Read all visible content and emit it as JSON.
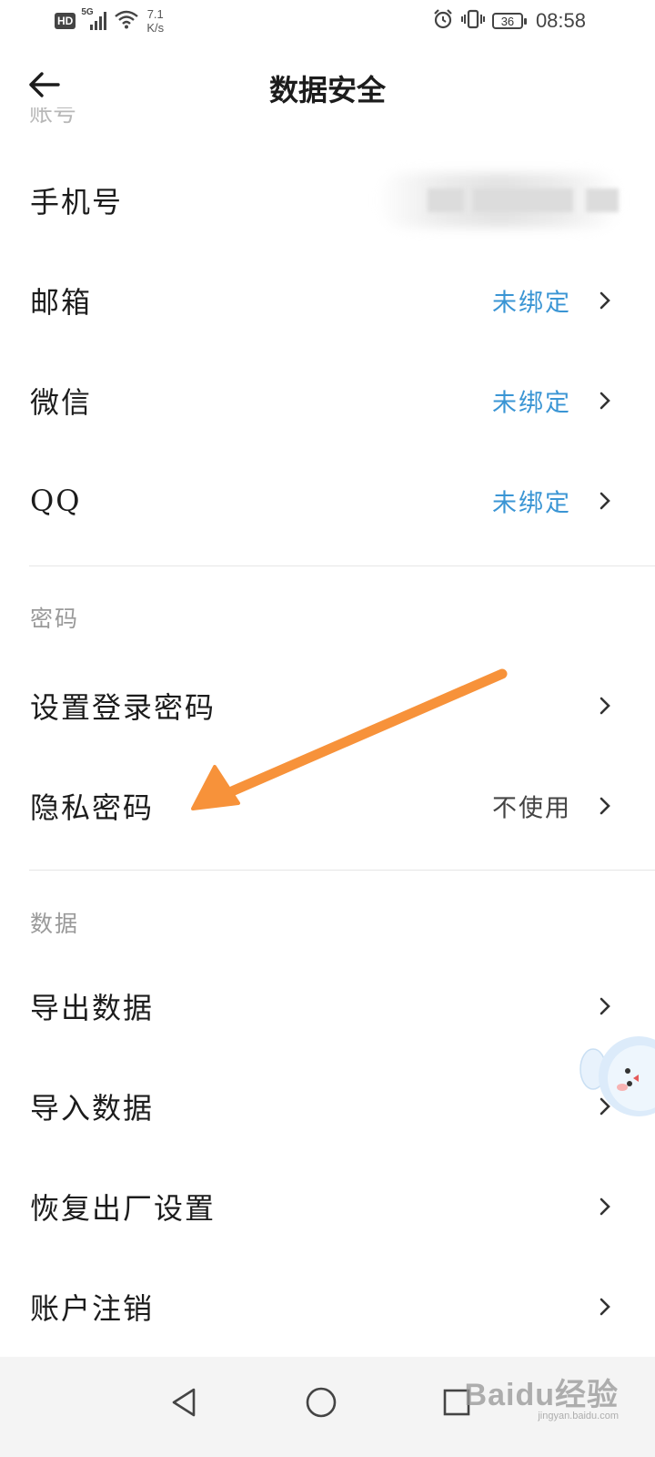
{
  "status_bar": {
    "hd": "HD",
    "network": "5G",
    "speed_value": "7.1",
    "speed_unit": "K/s",
    "battery": "36",
    "time": "08:58"
  },
  "header": {
    "title": "数据安全",
    "back_icon": "arrow-left-icon"
  },
  "account": {
    "partial_header": "账号",
    "rows": [
      {
        "label": "手机号",
        "value": ""
      },
      {
        "label": "邮箱",
        "value": "未绑定"
      },
      {
        "label": "微信",
        "value": "未绑定"
      },
      {
        "label": "QQ",
        "value": "未绑定"
      }
    ]
  },
  "password": {
    "header": "密码",
    "rows": [
      {
        "label": "设置登录密码",
        "value": ""
      },
      {
        "label": "隐私密码",
        "value": "不使用"
      }
    ]
  },
  "data_section": {
    "header": "数据",
    "rows": [
      {
        "label": "导出数据"
      },
      {
        "label": "导入数据"
      },
      {
        "label": "恢复出厂设置"
      },
      {
        "label": "账户注销"
      }
    ]
  },
  "nav": {
    "back": "triangle-back-icon",
    "home": "circle-home-icon",
    "recents": "square-recents-icon"
  },
  "watermark": {
    "main": "Baidu经验",
    "sub": "jingyan.baidu.com"
  },
  "colors": {
    "accent_blue": "#3a95d4",
    "annotation_arrow": "#f7923a",
    "section_gray": "#9a9a9a"
  }
}
